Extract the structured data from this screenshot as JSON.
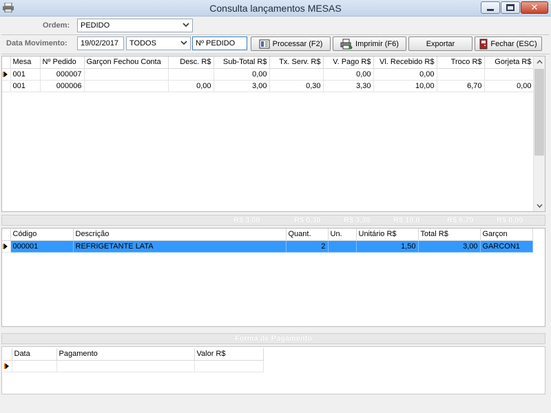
{
  "window": {
    "title": "Consulta lançamentos MESAS",
    "close_glyph": "✕"
  },
  "toolbar": {
    "ordem_label": "Ordem:",
    "ordem_value": "PEDIDO",
    "data_movimento_label": "Data Movimento:",
    "data_value": "19/02/2017",
    "filtro_value": "TODOS",
    "pedido_field_value": "Nº PEDIDO",
    "processar_label": "Processar (F2)",
    "imprimir_label": "Imprimir (F6)",
    "exportar_label": "Exportar",
    "fechar_label": "Fechar (ESC)"
  },
  "pedidos": {
    "columns": [
      "Mesa",
      "Nº Pedido",
      "Garçon Fechou Conta",
      "Desc. R$",
      "Sub-Total R$",
      "Tx. Serv. R$",
      "V. Pago R$",
      "Vl. Recebido R$",
      "Troco R$",
      "Gorjeta R$"
    ],
    "rows": [
      [
        "001",
        "000007",
        "",
        "",
        "0,00",
        "",
        "0,00",
        "0,00",
        "",
        ""
      ],
      [
        "001",
        "000006",
        "",
        "0,00",
        "3,00",
        "0,30",
        "3,30",
        "10,00",
        "6,70",
        "0,00"
      ]
    ]
  },
  "totals": {
    "subtotal": "R$ 3,00",
    "tx_serv": "R$ 0,30",
    "v_pago": "R$ 3,30",
    "vl_recebido": "R$ 10,0",
    "troco": "R$ 6,70",
    "gorjeta": "R$ 0,00"
  },
  "itens": {
    "columns": [
      "Código",
      "Descrição",
      "Quant.",
      "Un.",
      "Unitário R$",
      "Total R$",
      "Garçon"
    ],
    "rows": [
      [
        "000001",
        "REFRIGETANTE LATA",
        "2",
        "",
        "1,50",
        "3,00",
        "GARCON1"
      ]
    ]
  },
  "pagamento": {
    "title": "Forma de Pagamento",
    "columns": [
      "Data",
      "Pagamento",
      "Valor R$"
    ]
  },
  "colors": {
    "selection": "#3399ff",
    "close_button": "#c6452d"
  }
}
